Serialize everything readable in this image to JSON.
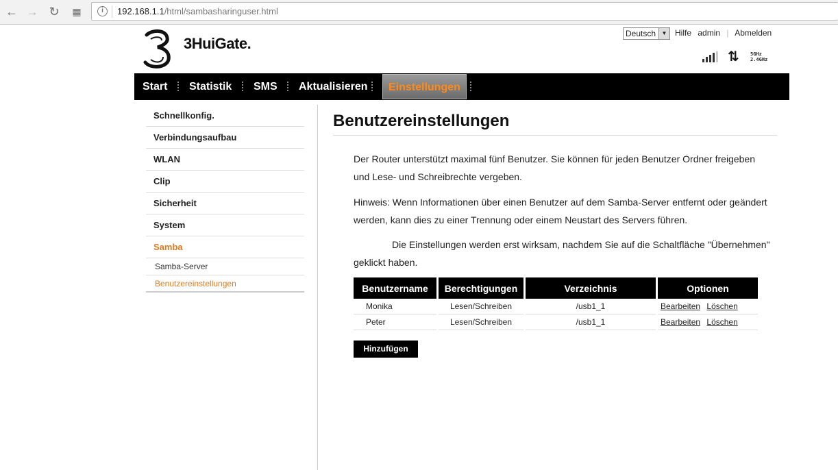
{
  "browser": {
    "url_host": "192.168.1.1",
    "url_path": "/html/sambasharinguser.html"
  },
  "header": {
    "brand": "3HuiGate.",
    "language": "Deutsch",
    "help": "Hilfe",
    "user": "admin",
    "logout": "Abmelden",
    "band_5": "5GHz",
    "band_24": "2.4GHz"
  },
  "nav": {
    "items": [
      "Start",
      "Statistik",
      "SMS",
      "Aktualisieren",
      "Einstellungen"
    ],
    "active": "Einstellungen",
    "active_color": "#ff8a1a"
  },
  "sidebar": {
    "items": [
      "Schnellkonfig.",
      "Verbindungsaufbau",
      "WLAN",
      "Clip",
      "Sicherheit",
      "System",
      "Samba"
    ],
    "sub_items": [
      "Samba-Server",
      "Benutzereinstellungen"
    ],
    "current_color": "#e07a1f"
  },
  "content": {
    "title": "Benutzereinstellungen",
    "para1": "Der Router unterstützt maximal fünf Benutzer. Sie können für jeden Benutzer Ordner freigeben und Lese- und Schreibrechte vergeben.",
    "para2": "Hinweis: Wenn Informationen über einen Benutzer auf dem Samba-Server entfernt oder geändert werden, kann dies zu einer Trennung oder einem Neustart des Servers führen.",
    "para3": "Die Einstellungen werden erst wirksam, nachdem Sie auf die Schaltfläche \"Übernehmen\" geklickt haben.",
    "table": {
      "headers": [
        "Benutzername",
        "Berechtigungen",
        "Verzeichnis",
        "Optionen"
      ],
      "rows": [
        {
          "name": "Monika",
          "perm": "Lesen/Schreiben",
          "dir": "/usb1_1",
          "edit": "Bearbeiten",
          "delete": "Löschen"
        },
        {
          "name": "Peter",
          "perm": "Lesen/Schreiben",
          "dir": "/usb1_1",
          "edit": "Bearbeiten",
          "delete": "Löschen"
        }
      ]
    },
    "add_button": "Hinzufügen"
  }
}
